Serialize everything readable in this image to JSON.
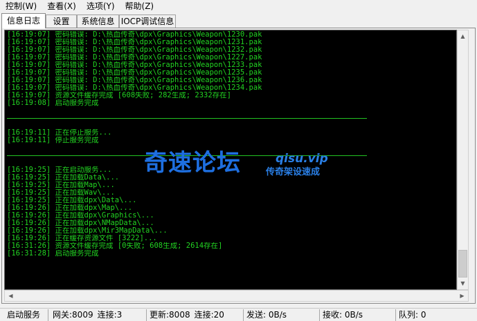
{
  "menubar": {
    "items": [
      "控制(W)",
      "查看(X)",
      "选项(Y)",
      "帮助(Z)"
    ]
  },
  "tabs": [
    "信息日志",
    "设置",
    "系统信息",
    "IOCP调试信息"
  ],
  "log": {
    "block1": [
      "[16:19:07] 密码错误: D:\\热血传奇\\dpx\\Graphics\\Weapon\\1230.pak",
      "[16:19:07] 密码错误: D:\\热血传奇\\dpx\\Graphics\\Weapon\\1231.pak",
      "[16:19:07] 密码错误: D:\\热血传奇\\dpx\\Graphics\\Weapon\\1232.pak",
      "[16:19:07] 密码错误: D:\\热血传奇\\dpx\\Graphics\\Weapon\\1227.pak",
      "[16:19:07] 密码错误: D:\\热血传奇\\dpx\\Graphics\\Weapon\\1233.pak",
      "[16:19:07] 密码错误: D:\\热血传奇\\dpx\\Graphics\\Weapon\\1235.pak",
      "[16:19:07] 密码错误: D:\\热血传奇\\dpx\\Graphics\\Weapon\\1236.pak",
      "[16:19:07] 密码错误: D:\\热血传奇\\dpx\\Graphics\\Weapon\\1234.pak",
      "[16:19:07] 资源文件缓存完成 [608失败; 282生成; 2332存在]",
      "[16:19:08] 启动服务完成"
    ],
    "block2": [
      "[16:19:11] 正在停止服务...",
      "[16:19:11] 停止服务完成"
    ],
    "block3": [
      "[16:19:25] 正在启动服务...",
      "[16:19:25] 正在加载Data\\...",
      "[16:19:25] 正在加载Map\\...",
      "[16:19:25] 正在加载Wav\\...",
      "[16:19:25] 正在加载dpx\\Data\\...",
      "[16:19:26] 正在加载dpx\\Map\\...",
      "[16:19:26] 正在加载dpx\\Graphics\\...",
      "[16:19:26] 正在加载dpx\\NMapData\\...",
      "[16:19:26] 正在加载dpx\\Mir3MapData\\...",
      "[16:19:26] 正在缓存资源文件 [3222]...",
      "[16:31:26] 资源文件缓存完成 [0失败; 608生成; 2614存在]",
      "[16:31:28] 启动服务完成"
    ]
  },
  "watermark": {
    "main": "奇速论坛",
    "site": "qisu.vip",
    "sub": "传奇架设速成"
  },
  "statusbar": {
    "service": "启动服务",
    "gateway": "网关:8009",
    "gateway_conn": "连接:3",
    "update": "更新:8008",
    "update_conn": "连接:20",
    "send": "发送: 0B/s",
    "recv": "接收: 0B/s",
    "queue": "队列: 0"
  },
  "colors": {
    "log_text": "#22d422",
    "log_bg": "#000000",
    "watermark": "#1e6fe0"
  }
}
